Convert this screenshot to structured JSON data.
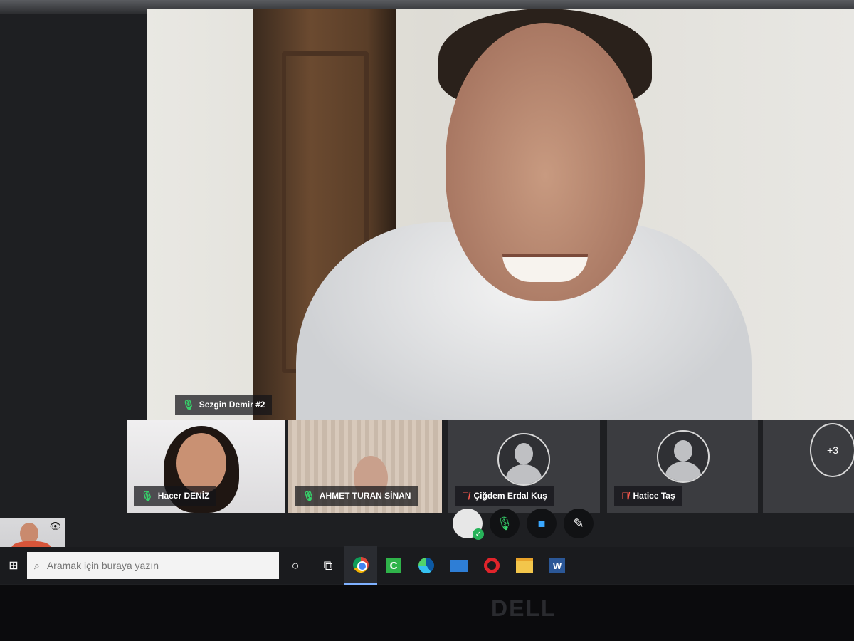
{
  "main_speaker": {
    "name": "Sezgin Demir #2",
    "mic": "on"
  },
  "participants": [
    {
      "name": "Hacer DENİZ",
      "mic": "on",
      "video": true
    },
    {
      "name": "AHMET TURAN SİNAN",
      "mic": "on",
      "video": true
    },
    {
      "name": "Çiğdem Erdal Kuş",
      "mic": "off",
      "video": false
    },
    {
      "name": "Hatice Taş",
      "mic": "off",
      "video": false
    }
  ],
  "more_participants": "+3",
  "controls": {
    "avatar_icon": "user-avatar-icon",
    "mic_icon": "microphone-icon",
    "camera_icon": "video-camera-icon",
    "share_icon": "screen-share-icon"
  },
  "taskbar": {
    "search_placeholder": "Aramak için buraya yazın",
    "apps": [
      "chrome-icon",
      "camtasia-icon",
      "edge-icon",
      "mail-icon",
      "opera-icon",
      "file-explorer-icon",
      "word-icon"
    ]
  },
  "bezel_brand": "DELL",
  "colors": {
    "mic_on": "#36d46b",
    "mic_off": "#ff5a4f",
    "camera": "#3aa8ff",
    "taskbar": "#1a1b1e"
  }
}
